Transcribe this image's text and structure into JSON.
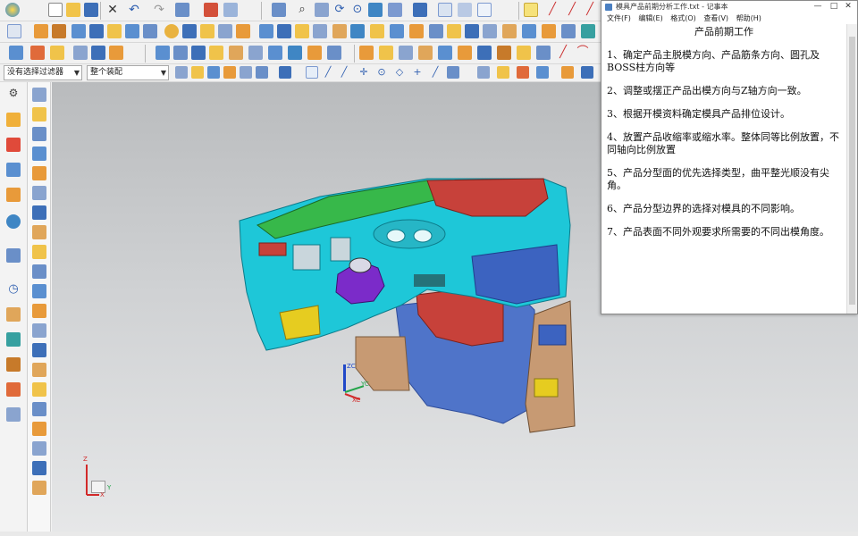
{
  "toolbar": {
    "filter_select_1": "没有选择过滤器",
    "filter_select_2": "整个装配"
  },
  "notepad": {
    "title": "模具产品前期分析工作.txt - 记事本",
    "menu": [
      "文件(F)",
      "编辑(E)",
      "格式(O)",
      "查看(V)",
      "帮助(H)"
    ],
    "window_buttons": [
      "—",
      "□",
      "✕"
    ],
    "heading": "产品前期工作",
    "items": [
      "1、确定产品主脱模方向、产品筋条方向、圆孔及BOSS柱方向等",
      "2、调整或摆正产品出模方向与Z轴方向一致。",
      "3、根据开模资料确定模具产品排位设计。",
      "4、放置产品收缩率或缩水率。整体同等比例放置，不同轴向比例放置",
      "5、产品分型面的优先选择类型，曲平整光顺没有尖角。",
      "6、产品分型边界的选择对模具的不同影响。",
      "7、产品表面不同外观要求所需要的不同出模角度。"
    ]
  },
  "viewport": {
    "axis_labels": {
      "z": "ZC",
      "y": "YC",
      "x": "XC"
    },
    "triad_labels": {
      "z": "Z",
      "y": "Y",
      "x": "X"
    }
  },
  "colors": {
    "cyan": "#1ec7d8",
    "red": "#c7413a",
    "green": "#37b84a",
    "blue": "#4f74c9",
    "tan": "#c79a73",
    "purple": "#7b2bc9",
    "yellow": "#e6cc20"
  }
}
